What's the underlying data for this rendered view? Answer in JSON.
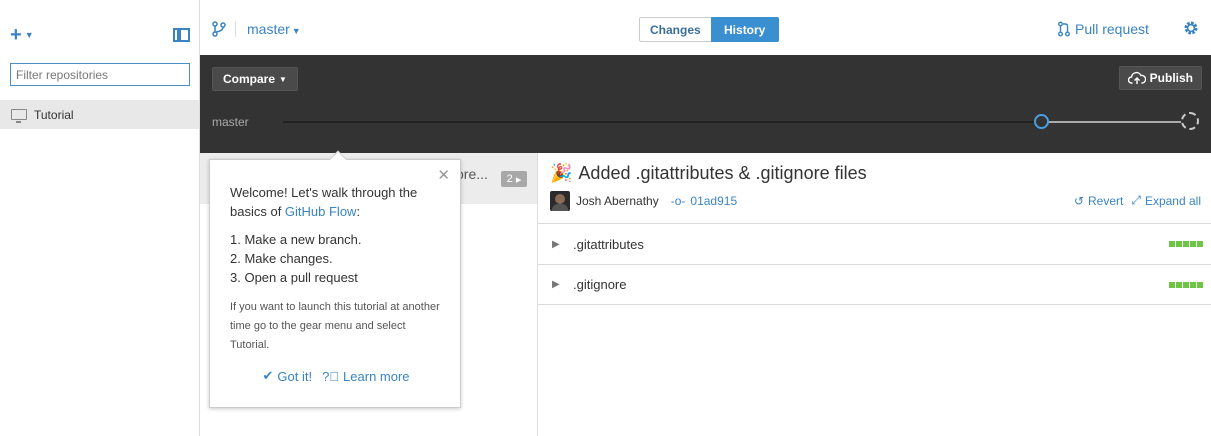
{
  "sidebar": {
    "add_icon": "plus-icon",
    "filter_placeholder": "Filter repositories",
    "repos": [
      {
        "label": "Tutorial",
        "icon": "monitor-icon"
      }
    ]
  },
  "topbar": {
    "branch": "master",
    "tabs": [
      {
        "label": "Changes",
        "active": false
      },
      {
        "label": "History",
        "active": true
      }
    ],
    "pull_request": "Pull request"
  },
  "timeline": {
    "compare": "Compare",
    "publish": "Publish",
    "branch_label": "master"
  },
  "commitlist": {
    "row_text": "ore...",
    "count": "2"
  },
  "detail": {
    "title": "Added .gitattributes & .gitignore files",
    "author": "Josh Abernathy",
    "sha": "01ad915",
    "revert": "Revert",
    "expand_all": "Expand all",
    "files": [
      {
        "name": ".gitattributes"
      },
      {
        "name": ".gitignore"
      }
    ]
  },
  "popover": {
    "welcome_prefix": "Welcome! Let's walk through the basics of ",
    "welcome_link": "GitHub Flow",
    "welcome_suffix": ":",
    "steps": [
      "1. Make a new branch.",
      "2. Make changes.",
      "3. Open a pull request"
    ],
    "note": "If you want to launch this tutorial at another time go to the gear menu and select Tutorial.",
    "got_it": "Got it!",
    "learn_more": "Learn more"
  },
  "colors": {
    "accent": "#3a84c4",
    "active_tab": "#3a8fd1",
    "timeline_bg": "#333333",
    "additions": "#6cc644"
  }
}
